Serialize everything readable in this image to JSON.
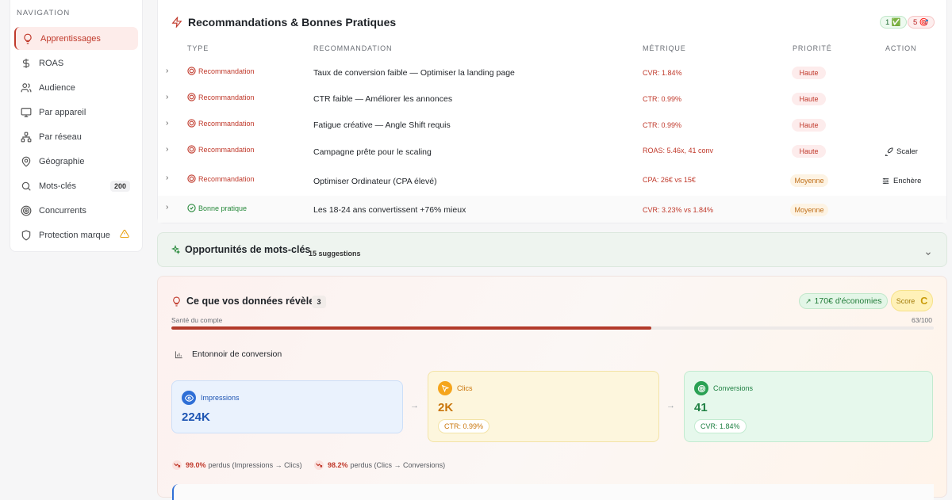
{
  "sidebar": {
    "title": "NAVIGATION",
    "items": [
      {
        "label": "Apprentissages",
        "icon": "lightbulb-icon",
        "active": true
      },
      {
        "label": "ROAS",
        "icon": "dollar-icon"
      },
      {
        "label": "Audience",
        "icon": "users-icon"
      },
      {
        "label": "Par appareil",
        "icon": "monitor-icon"
      },
      {
        "label": "Par réseau",
        "icon": "network-icon"
      },
      {
        "label": "Géographie",
        "icon": "map-pin-icon"
      },
      {
        "label": "Mots-clés",
        "icon": "search-icon",
        "badge": "200"
      },
      {
        "label": "Concurrents",
        "icon": "target-icon"
      },
      {
        "label": "Protection marque",
        "icon": "shield-icon",
        "warning": true
      }
    ]
  },
  "recommendations": {
    "title": "Recommandations & Bonnes Pratiques",
    "count_green": "1 ✅",
    "count_red": "5 🎯",
    "headers": {
      "type": "TYPE",
      "recommendation": "RECOMMANDATION",
      "metric": "MÉTRIQUE",
      "priority": "PRIORITÉ",
      "action": "ACTION"
    },
    "rows": [
      {
        "type": "Recommandation",
        "text": "Taux de conversion faible — Optimiser la landing page",
        "metric": "CVR: 1.84%",
        "priority": "Haute",
        "action": ""
      },
      {
        "type": "Recommandation",
        "text": "CTR faible — Améliorer les annonces",
        "metric": "CTR: 0.99%",
        "priority": "Haute",
        "action": ""
      },
      {
        "type": "Recommandation",
        "text": "Fatigue créative — Angle Shift requis",
        "metric": "CTR: 0.99%",
        "priority": "Haute",
        "action": ""
      },
      {
        "type": "Recommandation",
        "text": "Campagne prête pour le scaling",
        "metric": "ROAS: 5.46x, 41 conv",
        "priority": "Haute",
        "action": "Scaler"
      },
      {
        "type": "Recommandation",
        "text": "Optimiser Ordinateur (CPA élevé)",
        "metric": "CPA: 26€ vs 15€",
        "priority": "Moyenne",
        "action": "Enchère"
      },
      {
        "type": "Bonne pratique",
        "text": "Les 18-24 ans convertissent +76% mieux",
        "metric": "CVR: 3.23% vs 1.84%",
        "priority": "Moyenne",
        "action": ""
      }
    ]
  },
  "keywords": {
    "title": "Opportunités de mots-clés",
    "suggestions": "15 suggestions"
  },
  "insights": {
    "title": "Ce que vos données révèlent",
    "count": "3",
    "savings": "170€ d'économies",
    "score_label": "Score",
    "score_grade": "C",
    "health_label": "Santé du compte",
    "health_value": "63/100",
    "health_fraction": 0.63,
    "funnel_title": "Entonnoir de conversion",
    "stages": [
      {
        "label": "Impressions",
        "value": "224K"
      },
      {
        "label": "Clics",
        "value": "2K",
        "rate": "CTR: 0.99%"
      },
      {
        "label": "Conversions",
        "value": "41",
        "rate": "CVR: 1.84%"
      }
    ],
    "losses": [
      {
        "pct": "99.0%",
        "text": "perdus (Impressions → Clics)"
      },
      {
        "pct": "98.2%",
        "text": "perdus (Clics → Conversions)"
      }
    ]
  }
}
